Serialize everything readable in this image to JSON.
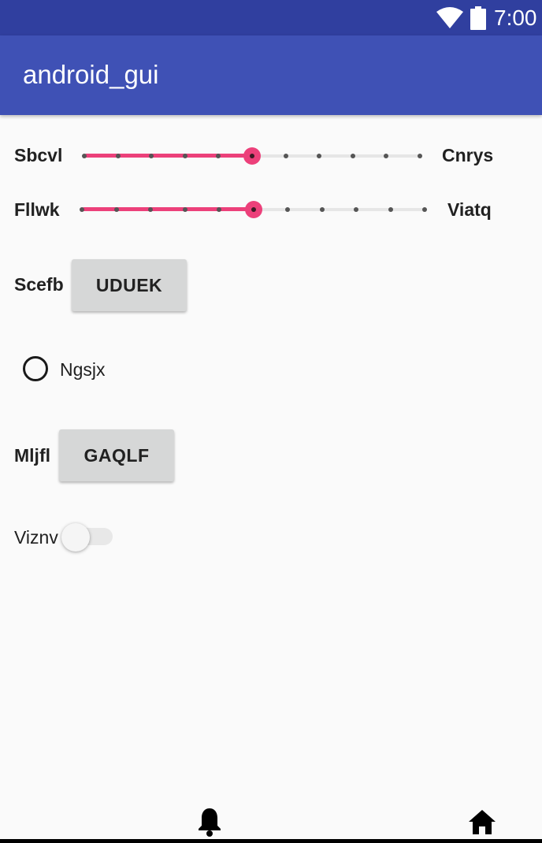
{
  "status_bar": {
    "time": "7:00",
    "wifi_icon": "wifi-icon",
    "battery_icon": "battery-icon"
  },
  "app_bar": {
    "title": "android_gui"
  },
  "seekbars": [
    {
      "label_left": "Sbcvl",
      "label_right": "Cnrys",
      "ticks": 11,
      "value_index": 5,
      "color": "#ec407a"
    },
    {
      "label_left": "Fllwk",
      "label_right": "Viatq",
      "ticks": 11,
      "value_index": 5,
      "color": "#ec407a"
    }
  ],
  "button_row_1": {
    "label": "Scefb",
    "button": "UDUEK"
  },
  "radio": {
    "label": "Ngsjx",
    "checked": false
  },
  "button_row_2": {
    "label": "Mljfl",
    "button": "GAQLF"
  },
  "switch": {
    "label": "Viznv",
    "checked": false
  },
  "bottom_icons": [
    "bell-icon",
    "home-icon"
  ],
  "colors": {
    "primary": "#3f51b5",
    "primary_dark": "#303f9f",
    "accent": "#ec407a"
  }
}
